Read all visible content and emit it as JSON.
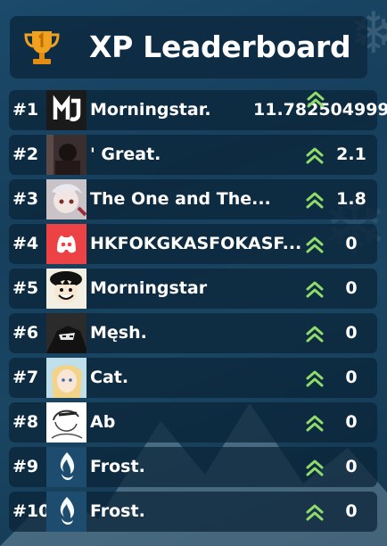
{
  "header": {
    "title": "XP Leaderboard",
    "icon": "trophy-icon"
  },
  "colors": {
    "accent_green": "#8fdc6b",
    "panel": "#0c263c",
    "trophy": "#f0a21e"
  },
  "rows": [
    {
      "rank": "#1",
      "name": "Morningstar.",
      "xp": "11.782504999",
      "avatar": "mj-logo-avatar"
    },
    {
      "rank": "#2",
      "name": "'  Great.",
      "xp": "2.1",
      "avatar": "photo-avatar"
    },
    {
      "rank": "#3",
      "name": "The One and The...",
      "xp": "1.8",
      "avatar": "anime-avatar"
    },
    {
      "rank": "#4",
      "name": "HKFOKGKASFOKASF...",
      "xp": "0",
      "avatar": "discord-avatar"
    },
    {
      "rank": "#5",
      "name": "Morningstar",
      "xp": "0",
      "avatar": "luffy-avatar"
    },
    {
      "rank": "#6",
      "name": "Męsh.",
      "xp": "0",
      "avatar": "dark-anime-avatar"
    },
    {
      "rank": "#7",
      "name": "Cat.",
      "xp": "0",
      "avatar": "blonde-anime-avatar"
    },
    {
      "rank": "#8",
      "name": "Ab",
      "xp": "0",
      "avatar": "sketch-avatar"
    },
    {
      "rank": "#9",
      "name": "Frost.",
      "xp": "0",
      "avatar": "frost-flame-avatar"
    },
    {
      "rank": "#10",
      "name": "Frost.",
      "xp": "0",
      "avatar": "frost-flame-avatar"
    }
  ]
}
